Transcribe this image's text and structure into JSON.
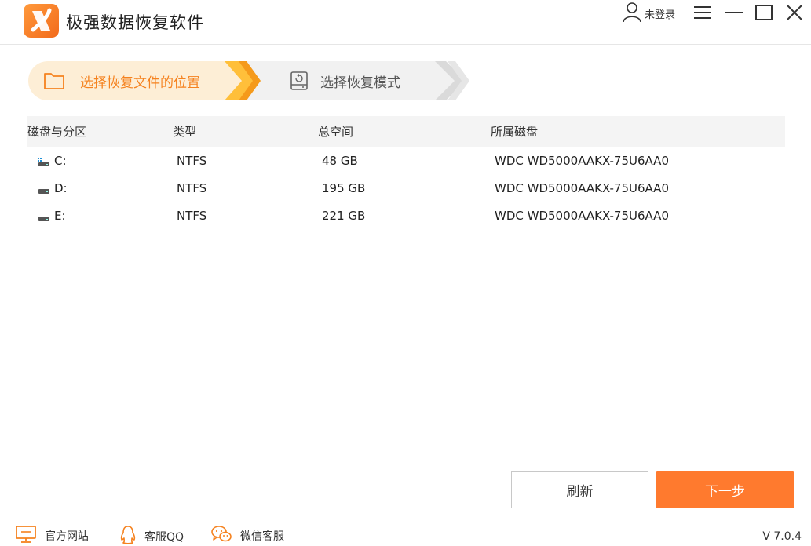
{
  "app": {
    "title": "极强数据恢复软件",
    "user_label": "未登录",
    "accent": "#ff7a2e"
  },
  "steps": [
    {
      "label": "选择恢复文件的位置",
      "icon": "folder-icon",
      "active": true
    },
    {
      "label": "选择恢复模式",
      "icon": "disk-restore-icon",
      "active": false
    }
  ],
  "table": {
    "headers": [
      "磁盘与分区",
      "类型",
      "总空间",
      "所属磁盘"
    ],
    "rows": [
      {
        "name": "C:",
        "type": "NTFS",
        "size": "48 GB",
        "disk": "WDC WD5000AAKX-75U6AA0",
        "icon": "system-drive-icon"
      },
      {
        "name": "D:",
        "type": "NTFS",
        "size": "195 GB",
        "disk": "WDC WD5000AAKX-75U6AA0",
        "icon": "drive-icon"
      },
      {
        "name": "E:",
        "type": "NTFS",
        "size": "221 GB",
        "disk": "WDC WD5000AAKX-75U6AA0",
        "icon": "drive-icon"
      }
    ]
  },
  "buttons": {
    "refresh": "刷新",
    "next": "下一步"
  },
  "footer": {
    "links": [
      {
        "label": "官方网站",
        "icon": "monitor-icon"
      },
      {
        "label": "客服QQ",
        "icon": "qq-icon"
      },
      {
        "label": "微信客服",
        "icon": "wechat-icon"
      }
    ],
    "version": "V 7.0.4"
  }
}
